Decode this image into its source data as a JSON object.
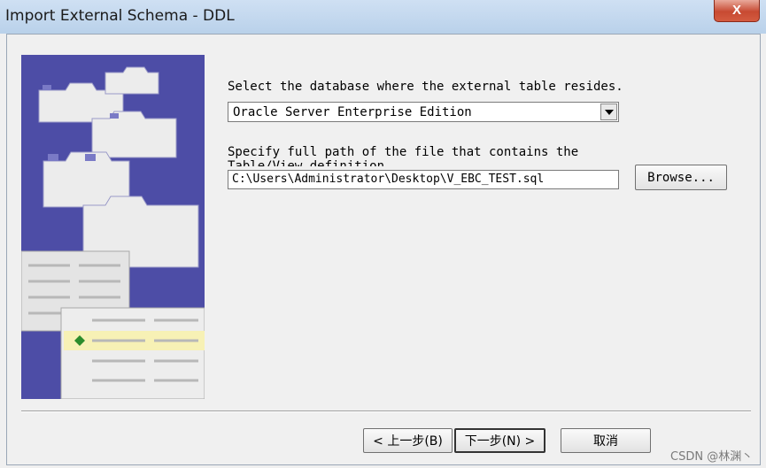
{
  "window": {
    "title": "Import External Schema - DDL",
    "close_glyph": "X"
  },
  "form": {
    "db_label": "Select the database where the external table resides.",
    "db_selected": "Oracle Server Enterprise Edition",
    "path_label_line1": "Specify full path of the file that contains the",
    "path_label_line2": "Table/View definition",
    "path_value": "C:\\Users\\Administrator\\Desktop\\V_EBC_TEST.sql",
    "browse_label": "Browse..."
  },
  "footer": {
    "back_label": "< 上一步(B)",
    "next_label": "下一步(N) >",
    "cancel_label": "取消"
  },
  "watermark": "CSDN @林渊丶",
  "colors": {
    "illustration_bg": "#4d4da6",
    "titlebar": "#b9d1ea",
    "close": "#c74a32"
  },
  "icons": [
    "close-icon",
    "dropdown-arrow-icon",
    "wizard-illustration"
  ]
}
